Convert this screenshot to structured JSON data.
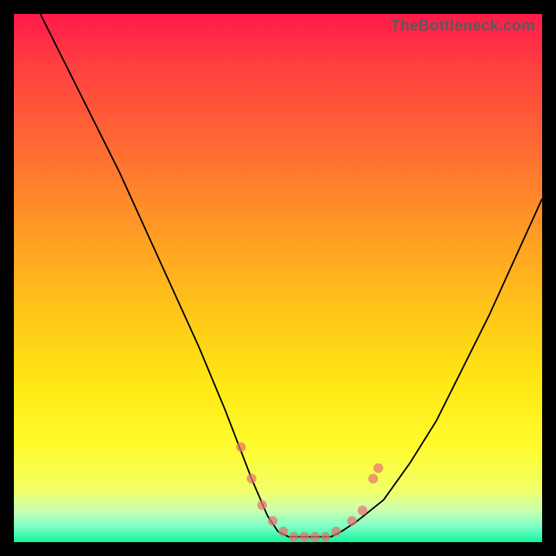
{
  "watermark": "TheBottleneck.com",
  "palette": {
    "frame_border": "#000000",
    "gradient_top": "#ff1a4a",
    "gradient_bottom": "#14f59a",
    "curve_stroke": "#000000",
    "marker_fill": "#e6736f"
  },
  "chart_data": {
    "type": "line",
    "title": "",
    "xlabel": "",
    "ylabel": "",
    "xlim": [
      0,
      100
    ],
    "ylim": [
      0,
      100
    ],
    "series": [
      {
        "name": "bottleneck-curve",
        "x": [
          5,
          10,
          15,
          20,
          25,
          30,
          35,
          40,
          45,
          48,
          50,
          52,
          55,
          58,
          60,
          62,
          65,
          70,
          75,
          80,
          85,
          90,
          95,
          100
        ],
        "y": [
          100,
          90,
          80,
          70,
          59,
          48,
          37,
          25,
          12,
          5,
          2,
          1,
          1,
          1,
          1,
          2,
          4,
          8,
          15,
          23,
          33,
          43,
          54,
          65
        ]
      }
    ],
    "markers": [
      {
        "x": 43,
        "y": 18
      },
      {
        "x": 45,
        "y": 12
      },
      {
        "x": 47,
        "y": 7
      },
      {
        "x": 49,
        "y": 4
      },
      {
        "x": 51,
        "y": 2
      },
      {
        "x": 53,
        "y": 1
      },
      {
        "x": 55,
        "y": 1
      },
      {
        "x": 57,
        "y": 1
      },
      {
        "x": 59,
        "y": 1
      },
      {
        "x": 61,
        "y": 2
      },
      {
        "x": 64,
        "y": 4
      },
      {
        "x": 66,
        "y": 6
      },
      {
        "x": 68,
        "y": 12
      },
      {
        "x": 69,
        "y": 14
      }
    ],
    "marker_radius_px": 7
  }
}
